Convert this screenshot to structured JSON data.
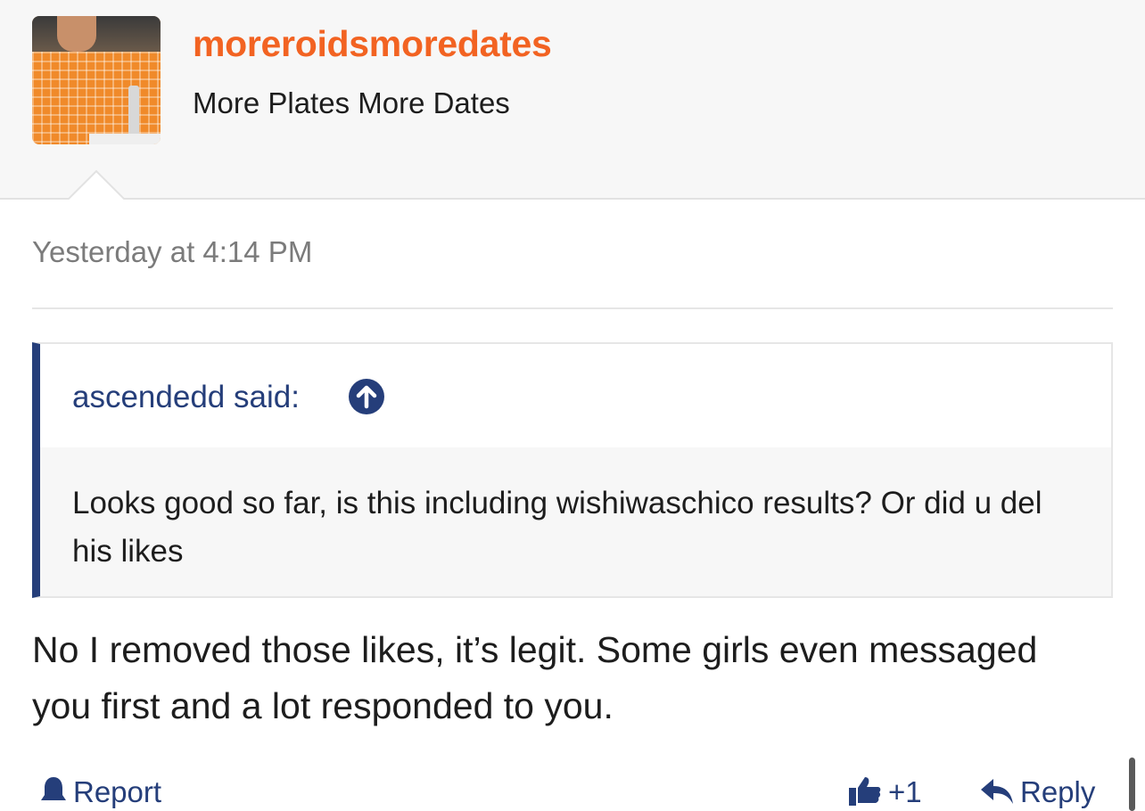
{
  "post": {
    "username": "moreroidsmoredates",
    "user_title": "More Plates More Dates",
    "timestamp": "Yesterday at 4:14 PM",
    "quote": {
      "author_line": "ascendedd said:",
      "text": "Looks good so far, is this including wishiwaschico results? Or did u del his likes"
    },
    "message": "No I removed those likes, it’s legit. Some girls even messaged you first and a lot responded to you.",
    "actions": {
      "report_label": "Report",
      "like_label": "+1",
      "reply_label": "Reply"
    }
  },
  "colors": {
    "username": "#f26322",
    "link": "#253e7a",
    "header_bg": "#f7f7f7"
  },
  "icons": {
    "quote_jump": "arrow-up-circle-icon",
    "report": "bell-icon",
    "like": "thumbs-up-icon",
    "reply": "reply-arrow-icon"
  }
}
